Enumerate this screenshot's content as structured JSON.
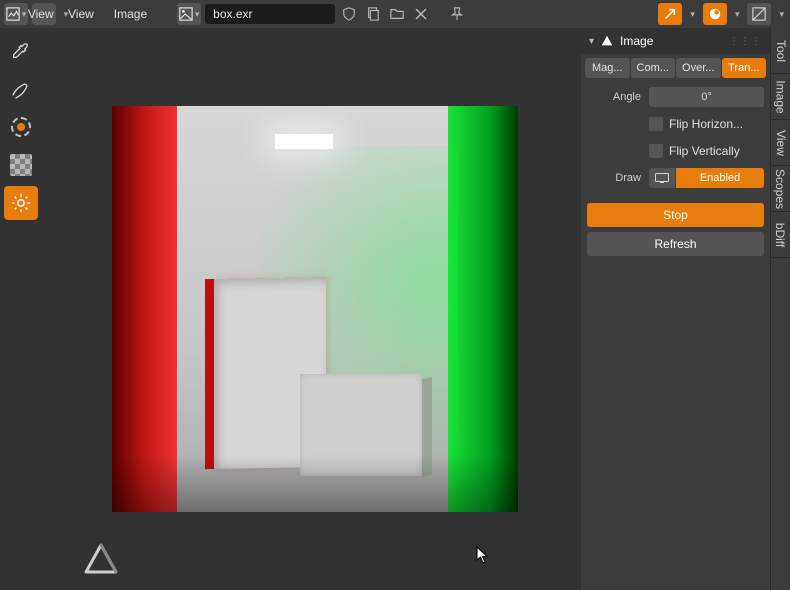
{
  "topbar": {
    "view_dropdown_label": "View",
    "view_menu": "View",
    "image_menu": "Image",
    "filename": "box.exr",
    "icons": {
      "editor": "image-editor-icon",
      "viewmode": "image-icon",
      "linked": "image-icon",
      "shield": "shield-icon",
      "copy": "copy-icon",
      "folder": "folder-icon",
      "close": "close-icon",
      "pin": "pin-icon",
      "arrow": "arrow-icon",
      "sphere": "sphere-icon",
      "diagonal": "diagonal-icon"
    }
  },
  "tools": [
    {
      "name": "eyedropper-tool",
      "active": false
    },
    {
      "name": "annotate-tool",
      "active": false
    },
    {
      "name": "sample-tool",
      "active": false
    },
    {
      "name": "checker-tool",
      "active": false
    },
    {
      "name": "gear-tool",
      "active": true
    }
  ],
  "panel": {
    "title": "Image",
    "tabs": [
      {
        "label": "Mag...",
        "active": false
      },
      {
        "label": "Com...",
        "active": false
      },
      {
        "label": "Over...",
        "active": false
      },
      {
        "label": "Tran...",
        "active": true
      }
    ],
    "angle_label": "Angle",
    "angle_value": "0°",
    "flip_h_label": "Flip Horizon...",
    "flip_v_label": "Flip Vertically",
    "draw_label": "Draw",
    "draw_value": "Enabled",
    "stop_label": "Stop",
    "refresh_label": "Refresh"
  },
  "sidetabs": [
    {
      "label": "Tool"
    },
    {
      "label": "Image"
    },
    {
      "label": "View"
    },
    {
      "label": "Scopes"
    },
    {
      "label": "bDiff"
    }
  ]
}
